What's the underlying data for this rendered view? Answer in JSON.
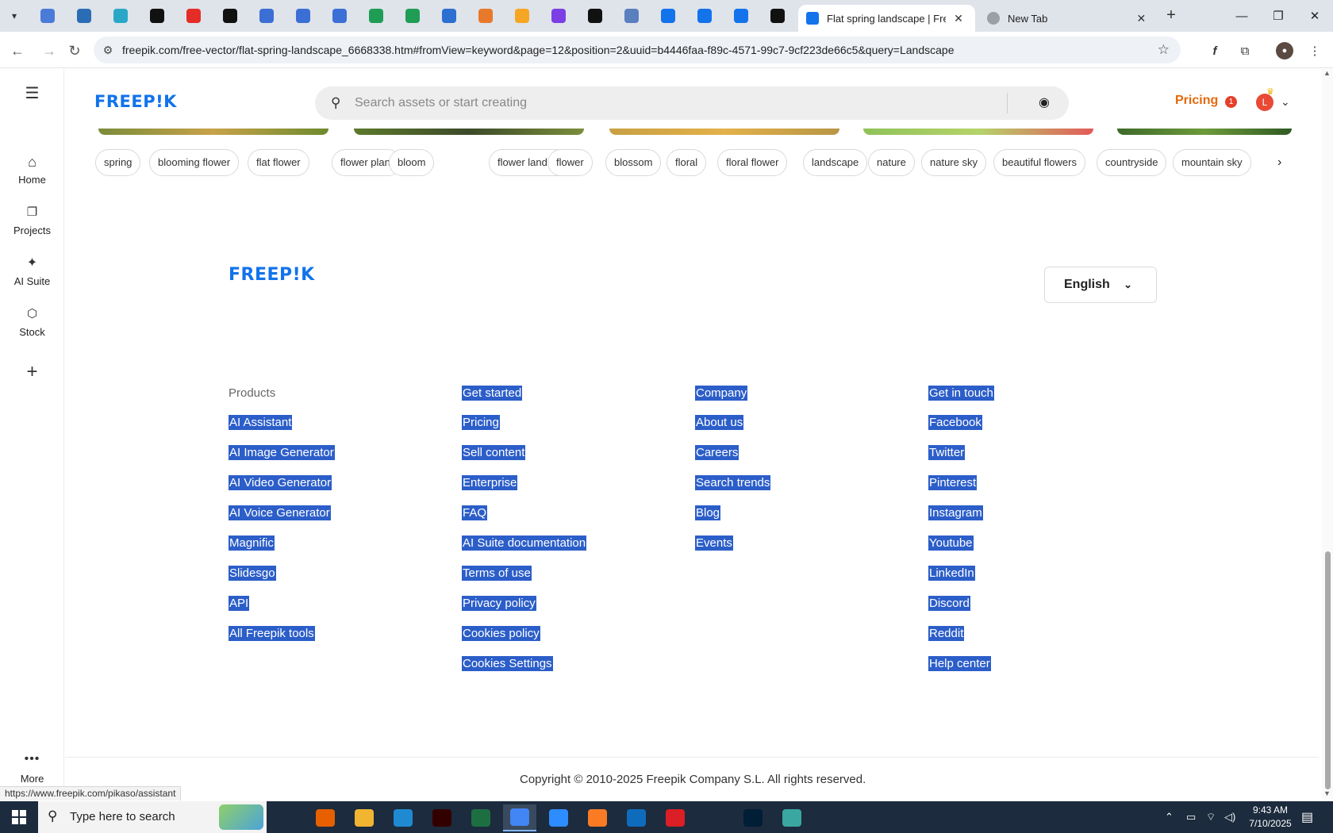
{
  "browser": {
    "pinned_tabs": [
      {
        "icon": "world-icon",
        "color": "#4a7bd8"
      },
      {
        "icon": "vpn-icon",
        "color": "#2a6db5"
      },
      {
        "icon": "arrow-app-icon",
        "color": "#2aa7c7"
      },
      {
        "icon": "openai-icon",
        "color": "#111111"
      },
      {
        "icon": "youtube-icon",
        "color": "#e52d27"
      },
      {
        "icon": "bolt-icon",
        "color": "#111111"
      },
      {
        "icon": "docs-icon",
        "color": "#3b6fd6"
      },
      {
        "icon": "docs-icon",
        "color": "#3b6fd6"
      },
      {
        "icon": "docs-icon",
        "color": "#3b6fd6"
      },
      {
        "icon": "sheets-icon",
        "color": "#1f9d55"
      },
      {
        "icon": "sheets-icon",
        "color": "#1f9d55"
      },
      {
        "icon": "word-icon",
        "color": "#2b6fd0"
      },
      {
        "icon": "box-icon",
        "color": "#e8792b"
      },
      {
        "icon": "wave-icon",
        "color": "#f5a623"
      },
      {
        "icon": "code-icon",
        "color": "#7b3fe4"
      },
      {
        "icon": "aa-icon",
        "color": "#111111"
      },
      {
        "icon": "grid-icon",
        "color": "#5a7fbf"
      },
      {
        "icon": "freepik-tab-icon",
        "color": "#1273eb"
      },
      {
        "icon": "freepik-tab-icon",
        "color": "#1273eb"
      },
      {
        "icon": "freepik-tab-icon",
        "color": "#1273eb"
      },
      {
        "icon": "m-icon",
        "color": "#111111"
      }
    ],
    "tabs": [
      {
        "title": "Flat spring landscape | Free Vector",
        "active": true
      },
      {
        "title": "New Tab",
        "active": false
      }
    ],
    "url": "freepik.com/free-vector/flat-spring-landscape_6668338.htm#fromView=keyword&page=12&position=2&uuid=b4446faa-f89c-4571-99c7-9cf223de66c5&query=Landscape",
    "status_url": "https://www.freepik.com/pikaso/assistant"
  },
  "site": {
    "logo": "FREEP!K",
    "search_placeholder": "Search assets or start creating",
    "pricing": "Pricing",
    "notifications_count": "1",
    "avatar_initial": "L",
    "left_nav": [
      {
        "label": "Home",
        "icon": "home-icon"
      },
      {
        "label": "Projects",
        "icon": "projects-icon"
      },
      {
        "label": "AI Suite",
        "icon": "sparkles-icon"
      },
      {
        "label": "Stock",
        "icon": "stock-icon"
      }
    ],
    "more_label": "More",
    "tags": [
      "spring",
      "blooming flower",
      "flat flower",
      "flower plant",
      "bloom",
      "flower landscape",
      "flower",
      "blossom",
      "floral",
      "floral flower",
      "landscape",
      "nature",
      "nature sky",
      "beautiful flowers",
      "countryside",
      "mountain sky"
    ],
    "footer": {
      "logo": "FREEP!K",
      "language": "English",
      "columns": [
        {
          "heading": "Products",
          "heading_selected": false,
          "links": [
            "AI Assistant",
            "AI Image Generator",
            "AI Video Generator",
            "AI Voice Generator",
            "Magnific",
            "Slidesgo",
            "API",
            "All Freepik tools"
          ]
        },
        {
          "heading": "Get started",
          "heading_selected": true,
          "links": [
            "Pricing",
            "Sell content",
            "Enterprise",
            "FAQ",
            "AI Suite documentation",
            "Terms of use",
            "Privacy policy",
            "Cookies policy",
            "Cookies Settings"
          ]
        },
        {
          "heading": "Company",
          "heading_selected": true,
          "links": [
            "About us",
            "Careers",
            "Search trends",
            "Blog",
            "Events"
          ]
        },
        {
          "heading": "Get in touch",
          "heading_selected": true,
          "links": [
            "Facebook",
            "Twitter",
            "Pinterest",
            "Instagram",
            "Youtube",
            "LinkedIn",
            "Discord",
            "Reddit",
            "Help center"
          ]
        }
      ],
      "copyright": "Copyright © 2010-2025 Freepik Company S.L. All rights reserved."
    }
  },
  "taskbar": {
    "search_placeholder": "Type here to search",
    "apps": [
      {
        "icon": "task-view-icon",
        "color": "#1c2b3d"
      },
      {
        "icon": "firefox-icon",
        "color": "#e66000"
      },
      {
        "icon": "file-explorer-icon",
        "color": "#f2b531"
      },
      {
        "icon": "vscode-icon",
        "color": "#1f8ad2"
      },
      {
        "icon": "illustrator-icon",
        "color": "#330000"
      },
      {
        "icon": "excel-icon",
        "color": "#1d6f42"
      },
      {
        "icon": "chrome-icon",
        "color": "#4285f4"
      },
      {
        "icon": "zoom-icon",
        "color": "#2d8cff"
      },
      {
        "icon": "xampp-icon",
        "color": "#fb7a24"
      },
      {
        "icon": "outlook-icon",
        "color": "#0f6cbd"
      },
      {
        "icon": "creative-cloud-icon",
        "color": "#da1f26"
      },
      {
        "icon": "pen-tool-icon",
        "color": "#1c2b3d"
      },
      {
        "icon": "photoshop-icon",
        "color": "#001e36"
      },
      {
        "icon": "app-diamond-icon",
        "color": "#3aa7a0"
      }
    ],
    "time": "9:43 AM",
    "date": "7/10/2025"
  }
}
